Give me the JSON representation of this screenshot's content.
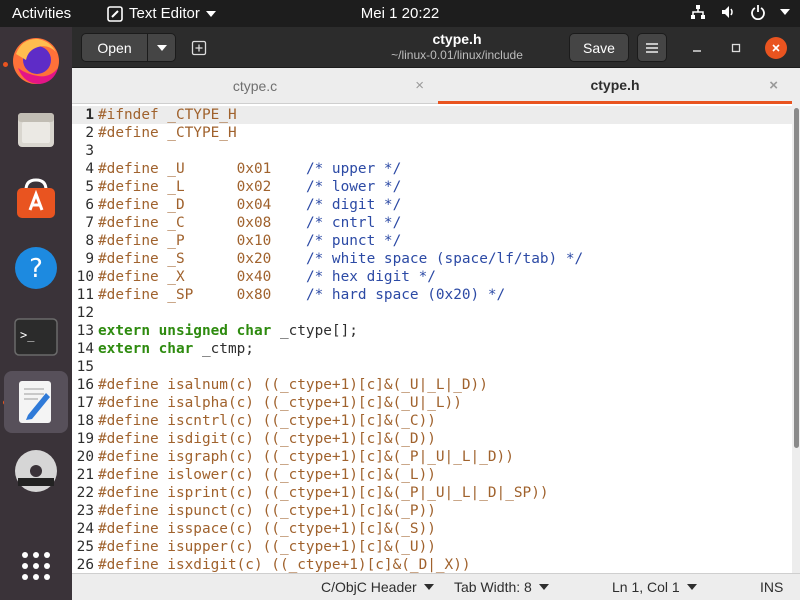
{
  "topbar": {
    "activities": "Activities",
    "app_name": "Text Editor",
    "clock": "Mei 1  20:22",
    "icons": [
      "network-icon",
      "volume-icon",
      "power-icon"
    ]
  },
  "dock": {
    "items": [
      "firefox-icon",
      "files-icon",
      "software-icon",
      "help-icon",
      "terminal-icon",
      "text-editor-icon",
      "dvd-icon",
      "app-grid-icon"
    ],
    "terminal_glyph": ">_",
    "help_glyph": "?"
  },
  "header": {
    "open_label": "Open",
    "title": "ctype.h",
    "subtitle": "~/linux-0.01/linux/include",
    "save_label": "Save"
  },
  "tabs": [
    {
      "label": "ctype.c",
      "active": false
    },
    {
      "label": "ctype.h",
      "active": true
    }
  ],
  "editor": {
    "lines": [
      {
        "n": "1",
        "parts": [
          [
            "pp",
            "#ifndef _CTYPE_H"
          ]
        ]
      },
      {
        "n": "2",
        "parts": [
          [
            "pp",
            "#define _CTYPE_H"
          ]
        ]
      },
      {
        "n": "3",
        "parts": []
      },
      {
        "n": "4",
        "parts": [
          [
            "pp",
            "#define _U      0x01    "
          ],
          [
            "cm",
            "/* upper */"
          ]
        ]
      },
      {
        "n": "5",
        "parts": [
          [
            "pp",
            "#define _L      0x02    "
          ],
          [
            "cm",
            "/* lower */"
          ]
        ]
      },
      {
        "n": "6",
        "parts": [
          [
            "pp",
            "#define _D      0x04    "
          ],
          [
            "cm",
            "/* digit */"
          ]
        ]
      },
      {
        "n": "7",
        "parts": [
          [
            "pp",
            "#define _C      0x08    "
          ],
          [
            "cm",
            "/* cntrl */"
          ]
        ]
      },
      {
        "n": "8",
        "parts": [
          [
            "pp",
            "#define _P      0x10    "
          ],
          [
            "cm",
            "/* punct */"
          ]
        ]
      },
      {
        "n": "9",
        "parts": [
          [
            "pp",
            "#define _S      0x20    "
          ],
          [
            "cm",
            "/* white space (space/lf/tab) */"
          ]
        ]
      },
      {
        "n": "10",
        "parts": [
          [
            "pp",
            "#define _X      0x40    "
          ],
          [
            "cm",
            "/* hex digit */"
          ]
        ]
      },
      {
        "n": "11",
        "parts": [
          [
            "pp",
            "#define _SP     0x80    "
          ],
          [
            "cm",
            "/* hard space (0x20) */"
          ]
        ]
      },
      {
        "n": "12",
        "parts": []
      },
      {
        "n": "13",
        "parts": [
          [
            "kw",
            "extern unsigned char"
          ],
          [
            "tx",
            " _ctype[];"
          ]
        ]
      },
      {
        "n": "14",
        "parts": [
          [
            "kw",
            "extern char"
          ],
          [
            "tx",
            " _ctmp;"
          ]
        ]
      },
      {
        "n": "15",
        "parts": []
      },
      {
        "n": "16",
        "parts": [
          [
            "pp",
            "#define isalnum(c) ((_ctype+1)[c]&(_U|_L|_D))"
          ]
        ]
      },
      {
        "n": "17",
        "parts": [
          [
            "pp",
            "#define isalpha(c) ((_ctype+1)[c]&(_U|_L))"
          ]
        ]
      },
      {
        "n": "18",
        "parts": [
          [
            "pp",
            "#define iscntrl(c) ((_ctype+1)[c]&(_C))"
          ]
        ]
      },
      {
        "n": "19",
        "parts": [
          [
            "pp",
            "#define isdigit(c) ((_ctype+1)[c]&(_D))"
          ]
        ]
      },
      {
        "n": "20",
        "parts": [
          [
            "pp",
            "#define isgraph(c) ((_ctype+1)[c]&(_P|_U|_L|_D))"
          ]
        ]
      },
      {
        "n": "21",
        "parts": [
          [
            "pp",
            "#define islower(c) ((_ctype+1)[c]&(_L))"
          ]
        ]
      },
      {
        "n": "22",
        "parts": [
          [
            "pp",
            "#define isprint(c) ((_ctype+1)[c]&(_P|_U|_L|_D|_SP))"
          ]
        ]
      },
      {
        "n": "23",
        "parts": [
          [
            "pp",
            "#define ispunct(c) ((_ctype+1)[c]&(_P))"
          ]
        ]
      },
      {
        "n": "24",
        "parts": [
          [
            "pp",
            "#define isspace(c) ((_ctype+1)[c]&(_S))"
          ]
        ]
      },
      {
        "n": "25",
        "parts": [
          [
            "pp",
            "#define isupper(c) ((_ctype+1)[c]&(_U))"
          ]
        ]
      },
      {
        "n": "26",
        "parts": [
          [
            "pp",
            "#define isxdigit(c) ((_ctype+1)[c]&(_D|_X))"
          ]
        ]
      }
    ]
  },
  "statusbar": {
    "language": "C/ObjC Header",
    "tab_width": "Tab Width: 8",
    "position": "Ln 1, Col 1",
    "mode": "INS"
  }
}
